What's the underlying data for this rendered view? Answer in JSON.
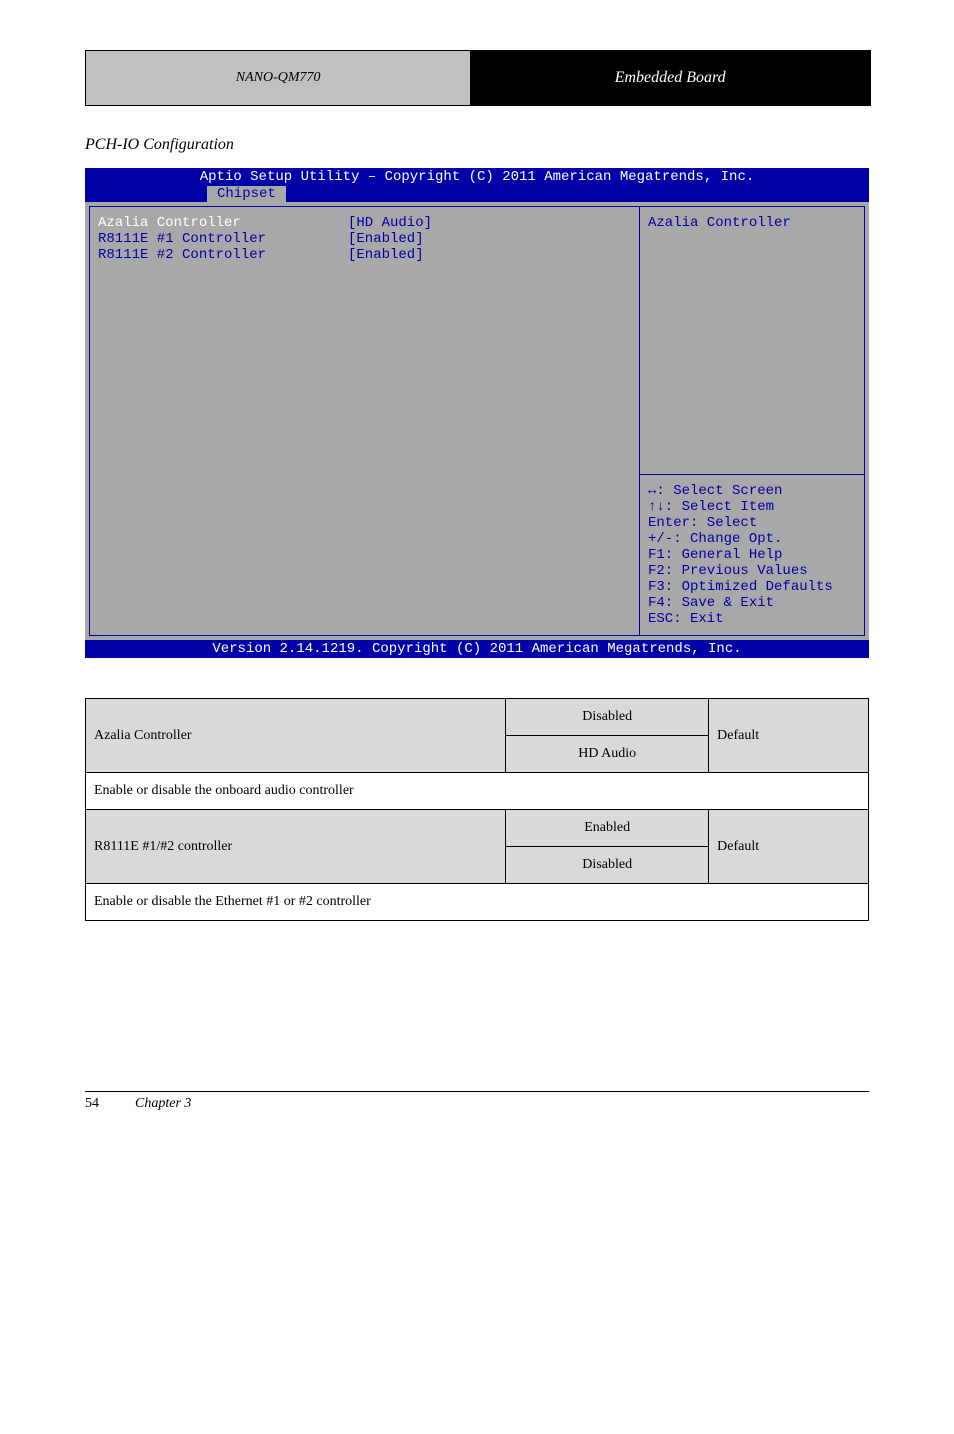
{
  "header": {
    "subtitle": "NANO-QM770",
    "title": "Embedded Board"
  },
  "section_heading": "PCH-IO Configuration",
  "bios": {
    "title": "Aptio Setup Utility – Copyright (C) 2011 American Megatrends, Inc.",
    "tab": "Chipset",
    "rows": [
      {
        "label": "Azalia Controller",
        "value": "[HD Audio]",
        "selected": true
      },
      {
        "label": "R8111E #1 Controller",
        "value": "[Enabled]"
      },
      {
        "label": "R8111E #2 Controller",
        "value": "[Enabled]"
      }
    ],
    "help_title": "Azalia Controller",
    "keys": [
      "↔: Select Screen",
      "↑↓: Select Item",
      "Enter: Select",
      "+/-: Change Opt.",
      "F1: General Help",
      "F2: Previous Values",
      "F3: Optimized Defaults",
      "F4: Save & Exit",
      "ESC: Exit"
    ],
    "footer": "Version 2.14.1219. Copyright (C) 2011 American Megatrends, Inc."
  },
  "table": {
    "r1": {
      "name": "Azalia Controller",
      "opt1": "Disabled",
      "opt2": "HD Audio",
      "default": "Default",
      "desc": "Enable or disable the onboard audio controller"
    },
    "r2": {
      "name": "R8111E #1/#2 controller",
      "opt1": "Enabled",
      "opt2": "Disabled",
      "default": "Default",
      "desc": "Enable or disable the Ethernet #1 or #2 controller"
    }
  },
  "footer": {
    "page": "54",
    "chapter": "Chapter 3"
  }
}
